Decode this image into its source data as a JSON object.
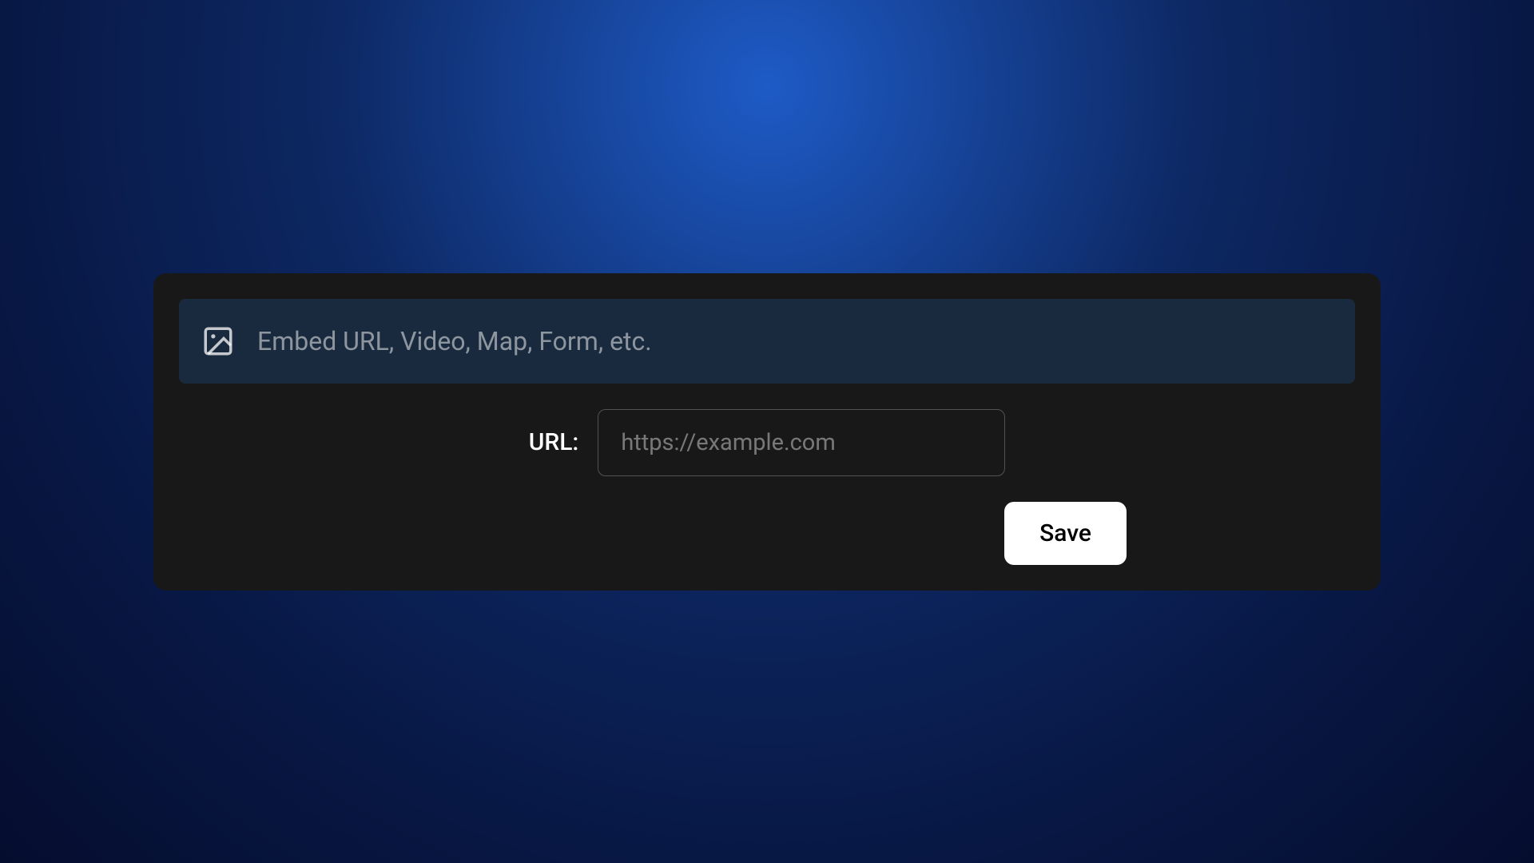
{
  "embed": {
    "label": "Embed URL, Video, Map, Form, etc."
  },
  "form": {
    "url_label": "URL:",
    "url_placeholder": "https://example.com",
    "url_value": "",
    "save_label": "Save"
  }
}
